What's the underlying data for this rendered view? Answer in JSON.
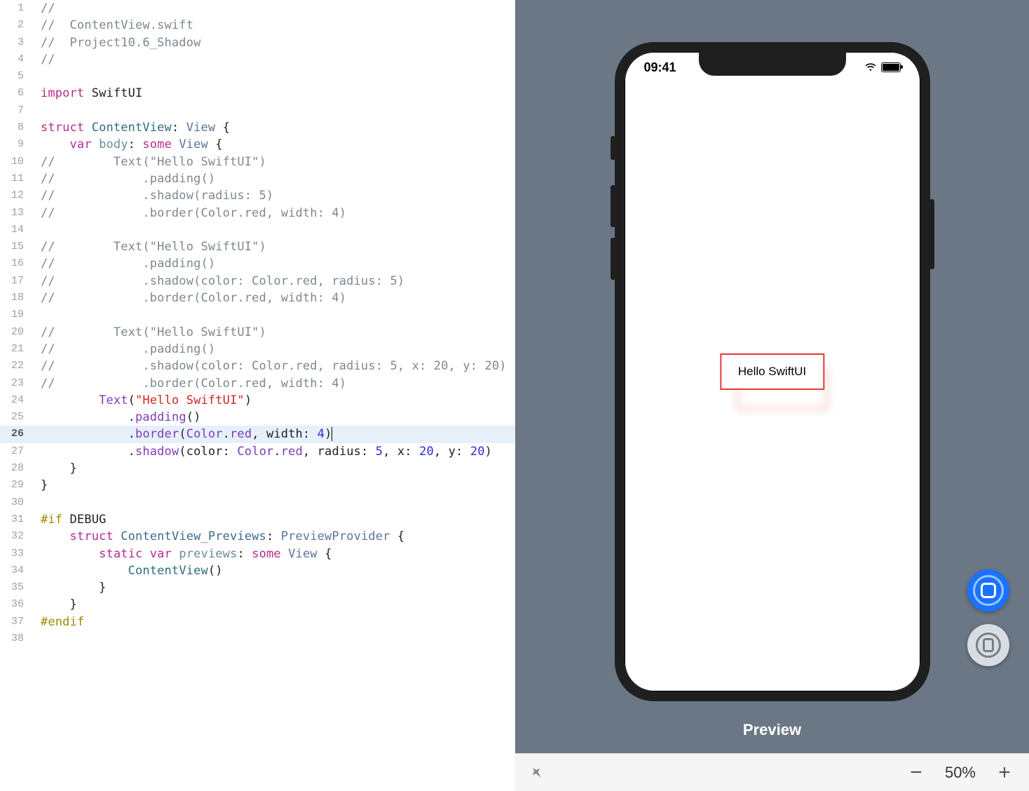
{
  "editor": {
    "active_line": 26,
    "lines": [
      {
        "n": 1,
        "tokens": [
          [
            "c-comment",
            "//"
          ]
        ]
      },
      {
        "n": 2,
        "tokens": [
          [
            "c-comment",
            "//  ContentView.swift"
          ]
        ]
      },
      {
        "n": 3,
        "tokens": [
          [
            "c-comment",
            "//  Project10.6_Shadow"
          ]
        ]
      },
      {
        "n": 4,
        "tokens": [
          [
            "c-comment",
            "//"
          ]
        ]
      },
      {
        "n": 5,
        "tokens": []
      },
      {
        "n": 6,
        "tokens": [
          [
            "c-kw2",
            "import"
          ],
          [
            "c-plain",
            " SwiftUI"
          ]
        ]
      },
      {
        "n": 7,
        "tokens": []
      },
      {
        "n": 8,
        "tokens": [
          [
            "c-kw",
            "struct"
          ],
          [
            "c-plain",
            " "
          ],
          [
            "c-ident",
            "ContentView"
          ],
          [
            "c-plain",
            ": "
          ],
          [
            "c-type",
            "View"
          ],
          [
            "c-plain",
            " {"
          ]
        ]
      },
      {
        "n": 9,
        "tokens": [
          [
            "c-plain",
            "    "
          ],
          [
            "c-kw",
            "var"
          ],
          [
            "c-plain",
            " "
          ],
          [
            "c-body",
            "body"
          ],
          [
            "c-plain",
            ": "
          ],
          [
            "c-kw",
            "some"
          ],
          [
            "c-plain",
            " "
          ],
          [
            "c-type",
            "View"
          ],
          [
            "c-plain",
            " {"
          ]
        ]
      },
      {
        "n": 10,
        "tokens": [
          [
            "c-comment",
            "//        Text(\"Hello SwiftUI\")"
          ]
        ]
      },
      {
        "n": 11,
        "tokens": [
          [
            "c-comment",
            "//            .padding()"
          ]
        ]
      },
      {
        "n": 12,
        "tokens": [
          [
            "c-comment",
            "//            .shadow(radius: 5)"
          ]
        ]
      },
      {
        "n": 13,
        "tokens": [
          [
            "c-comment",
            "//            .border(Color.red, width: 4)"
          ]
        ]
      },
      {
        "n": 14,
        "tokens": []
      },
      {
        "n": 15,
        "tokens": [
          [
            "c-comment",
            "//        Text(\"Hello SwiftUI\")"
          ]
        ]
      },
      {
        "n": 16,
        "tokens": [
          [
            "c-comment",
            "//            .padding()"
          ]
        ]
      },
      {
        "n": 17,
        "tokens": [
          [
            "c-comment",
            "//            .shadow(color: Color.red, radius: 5)"
          ]
        ]
      },
      {
        "n": 18,
        "tokens": [
          [
            "c-comment",
            "//            .border(Color.red, width: 4)"
          ]
        ]
      },
      {
        "n": 19,
        "tokens": []
      },
      {
        "n": 20,
        "tokens": [
          [
            "c-comment",
            "//        Text(\"Hello SwiftUI\")"
          ]
        ]
      },
      {
        "n": 21,
        "tokens": [
          [
            "c-comment",
            "//            .padding()"
          ]
        ]
      },
      {
        "n": 22,
        "tokens": [
          [
            "c-comment",
            "//            .shadow(color: Color.red, radius: 5, x: 20, y: 20)"
          ]
        ]
      },
      {
        "n": 23,
        "tokens": [
          [
            "c-comment",
            "//            .border(Color.red, width: 4)"
          ]
        ]
      },
      {
        "n": 24,
        "tokens": [
          [
            "c-plain",
            "        "
          ],
          [
            "c-func",
            "Text"
          ],
          [
            "c-plain",
            "("
          ],
          [
            "c-str",
            "\"Hello SwiftUI\""
          ],
          [
            "c-plain",
            ")"
          ]
        ]
      },
      {
        "n": 25,
        "tokens": [
          [
            "c-plain",
            "            ."
          ],
          [
            "c-func",
            "padding"
          ],
          [
            "c-plain",
            "()"
          ]
        ]
      },
      {
        "n": 26,
        "tokens": [
          [
            "c-plain",
            "            ."
          ],
          [
            "c-func",
            "border"
          ],
          [
            "c-plain",
            "("
          ],
          [
            "c-func",
            "Color"
          ],
          [
            "c-plain",
            "."
          ],
          [
            "c-func",
            "red"
          ],
          [
            "c-plain",
            ", width: "
          ],
          [
            "c-num",
            "4"
          ],
          [
            "c-plain",
            ")"
          ]
        ]
      },
      {
        "n": 27,
        "tokens": [
          [
            "c-plain",
            "            ."
          ],
          [
            "c-func",
            "shadow"
          ],
          [
            "c-plain",
            "(color: "
          ],
          [
            "c-func",
            "Color"
          ],
          [
            "c-plain",
            "."
          ],
          [
            "c-func",
            "red"
          ],
          [
            "c-plain",
            ", radius: "
          ],
          [
            "c-num",
            "5"
          ],
          [
            "c-plain",
            ", x: "
          ],
          [
            "c-num",
            "20"
          ],
          [
            "c-plain",
            ", y: "
          ],
          [
            "c-num",
            "20"
          ],
          [
            "c-plain",
            ")"
          ]
        ]
      },
      {
        "n": 28,
        "tokens": [
          [
            "c-plain",
            "    }"
          ]
        ]
      },
      {
        "n": 29,
        "tokens": [
          [
            "c-plain",
            "}"
          ]
        ]
      },
      {
        "n": 30,
        "tokens": []
      },
      {
        "n": 31,
        "tokens": [
          [
            "c-pre",
            "#if"
          ],
          [
            "c-plain",
            " DEBUG"
          ]
        ]
      },
      {
        "n": 32,
        "tokens": [
          [
            "c-plain",
            "    "
          ],
          [
            "c-kw",
            "struct"
          ],
          [
            "c-plain",
            " "
          ],
          [
            "c-id2",
            "ContentView_Previews"
          ],
          [
            "c-plain",
            ": "
          ],
          [
            "c-type",
            "PreviewProvider"
          ],
          [
            "c-plain",
            " {"
          ]
        ]
      },
      {
        "n": 33,
        "tokens": [
          [
            "c-plain",
            "        "
          ],
          [
            "c-kw",
            "static"
          ],
          [
            "c-plain",
            " "
          ],
          [
            "c-kw",
            "var"
          ],
          [
            "c-plain",
            " "
          ],
          [
            "c-body",
            "previews"
          ],
          [
            "c-plain",
            ": "
          ],
          [
            "c-kw",
            "some"
          ],
          [
            "c-plain",
            " "
          ],
          [
            "c-type",
            "View"
          ],
          [
            "c-plain",
            " {"
          ]
        ]
      },
      {
        "n": 34,
        "tokens": [
          [
            "c-plain",
            "            "
          ],
          [
            "c-ident",
            "ContentView"
          ],
          [
            "c-plain",
            "()"
          ]
        ]
      },
      {
        "n": 35,
        "tokens": [
          [
            "c-plain",
            "        }"
          ]
        ]
      },
      {
        "n": 36,
        "tokens": [
          [
            "c-plain",
            "    }"
          ]
        ]
      },
      {
        "n": 37,
        "tokens": [
          [
            "c-pre",
            "#endif"
          ]
        ]
      },
      {
        "n": 38,
        "tokens": []
      }
    ]
  },
  "preview": {
    "status_time": "09:41",
    "hello_text": "Hello SwiftUI",
    "label": "Preview"
  },
  "bottombar": {
    "zoom_label": "50%"
  }
}
